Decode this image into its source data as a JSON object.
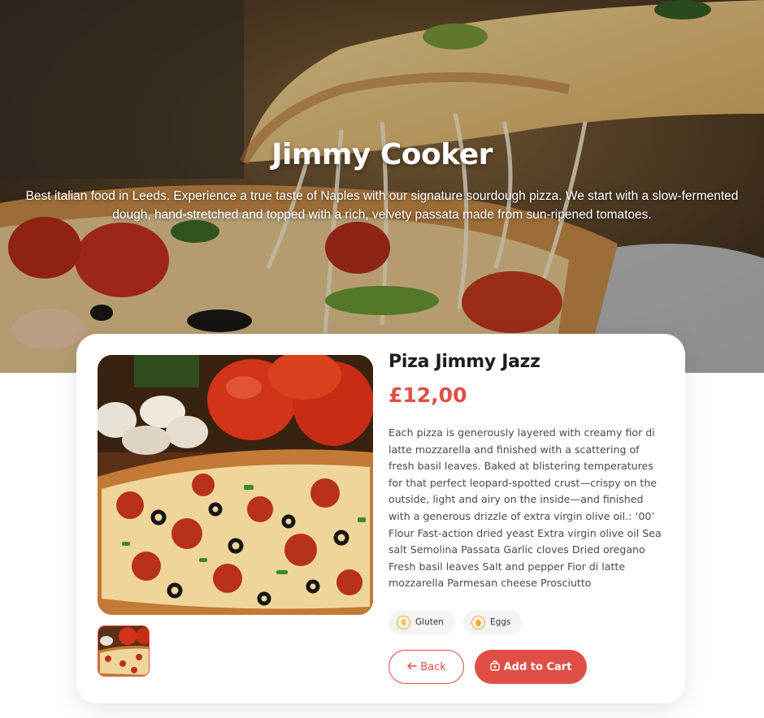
{
  "hero": {
    "title": "Jimmy Cooker",
    "description_line1": "Best italian food in Leeds. Experience a true taste of Naples with our signature sourdough pizza. We start with a slow-fermented",
    "description_line2": "dough, hand-stretched and topped with a rich, velvety passata made from sun-ripened tomatoes."
  },
  "product": {
    "name": "Piza Jimmy Jazz",
    "price": "£12,00",
    "description": "Each pizza is generously layered with creamy fior di latte mozzarella and finished with a scattering of fresh basil leaves. Baked at blistering temperatures for that perfect leopard-spotted crust—crispy on the outside, light and airy on the inside—and finished with a generous drizzle of extra virgin olive oil.: ‘00’ Flour Fast-action dried yeast Extra virgin olive oil Sea salt Semolina Passata Garlic cloves Dried oregano Fresh basil leaves Salt and pepper Fior di latte mozzarella Parmesan cheese Prosciutto",
    "allergens": [
      {
        "label": "Gluten",
        "icon": "wheat-icon"
      },
      {
        "label": "Eggs",
        "icon": "egg-icon"
      }
    ]
  },
  "actions": {
    "back_label": "Back",
    "back_icon": "arrow-left-icon",
    "cart_label": "Add to Cart",
    "cart_icon": "shopping-bag-icon"
  },
  "colors": {
    "accent": "#e04f45",
    "text": "#1e1e1e",
    "allergen_icon": "#e9a93a"
  }
}
